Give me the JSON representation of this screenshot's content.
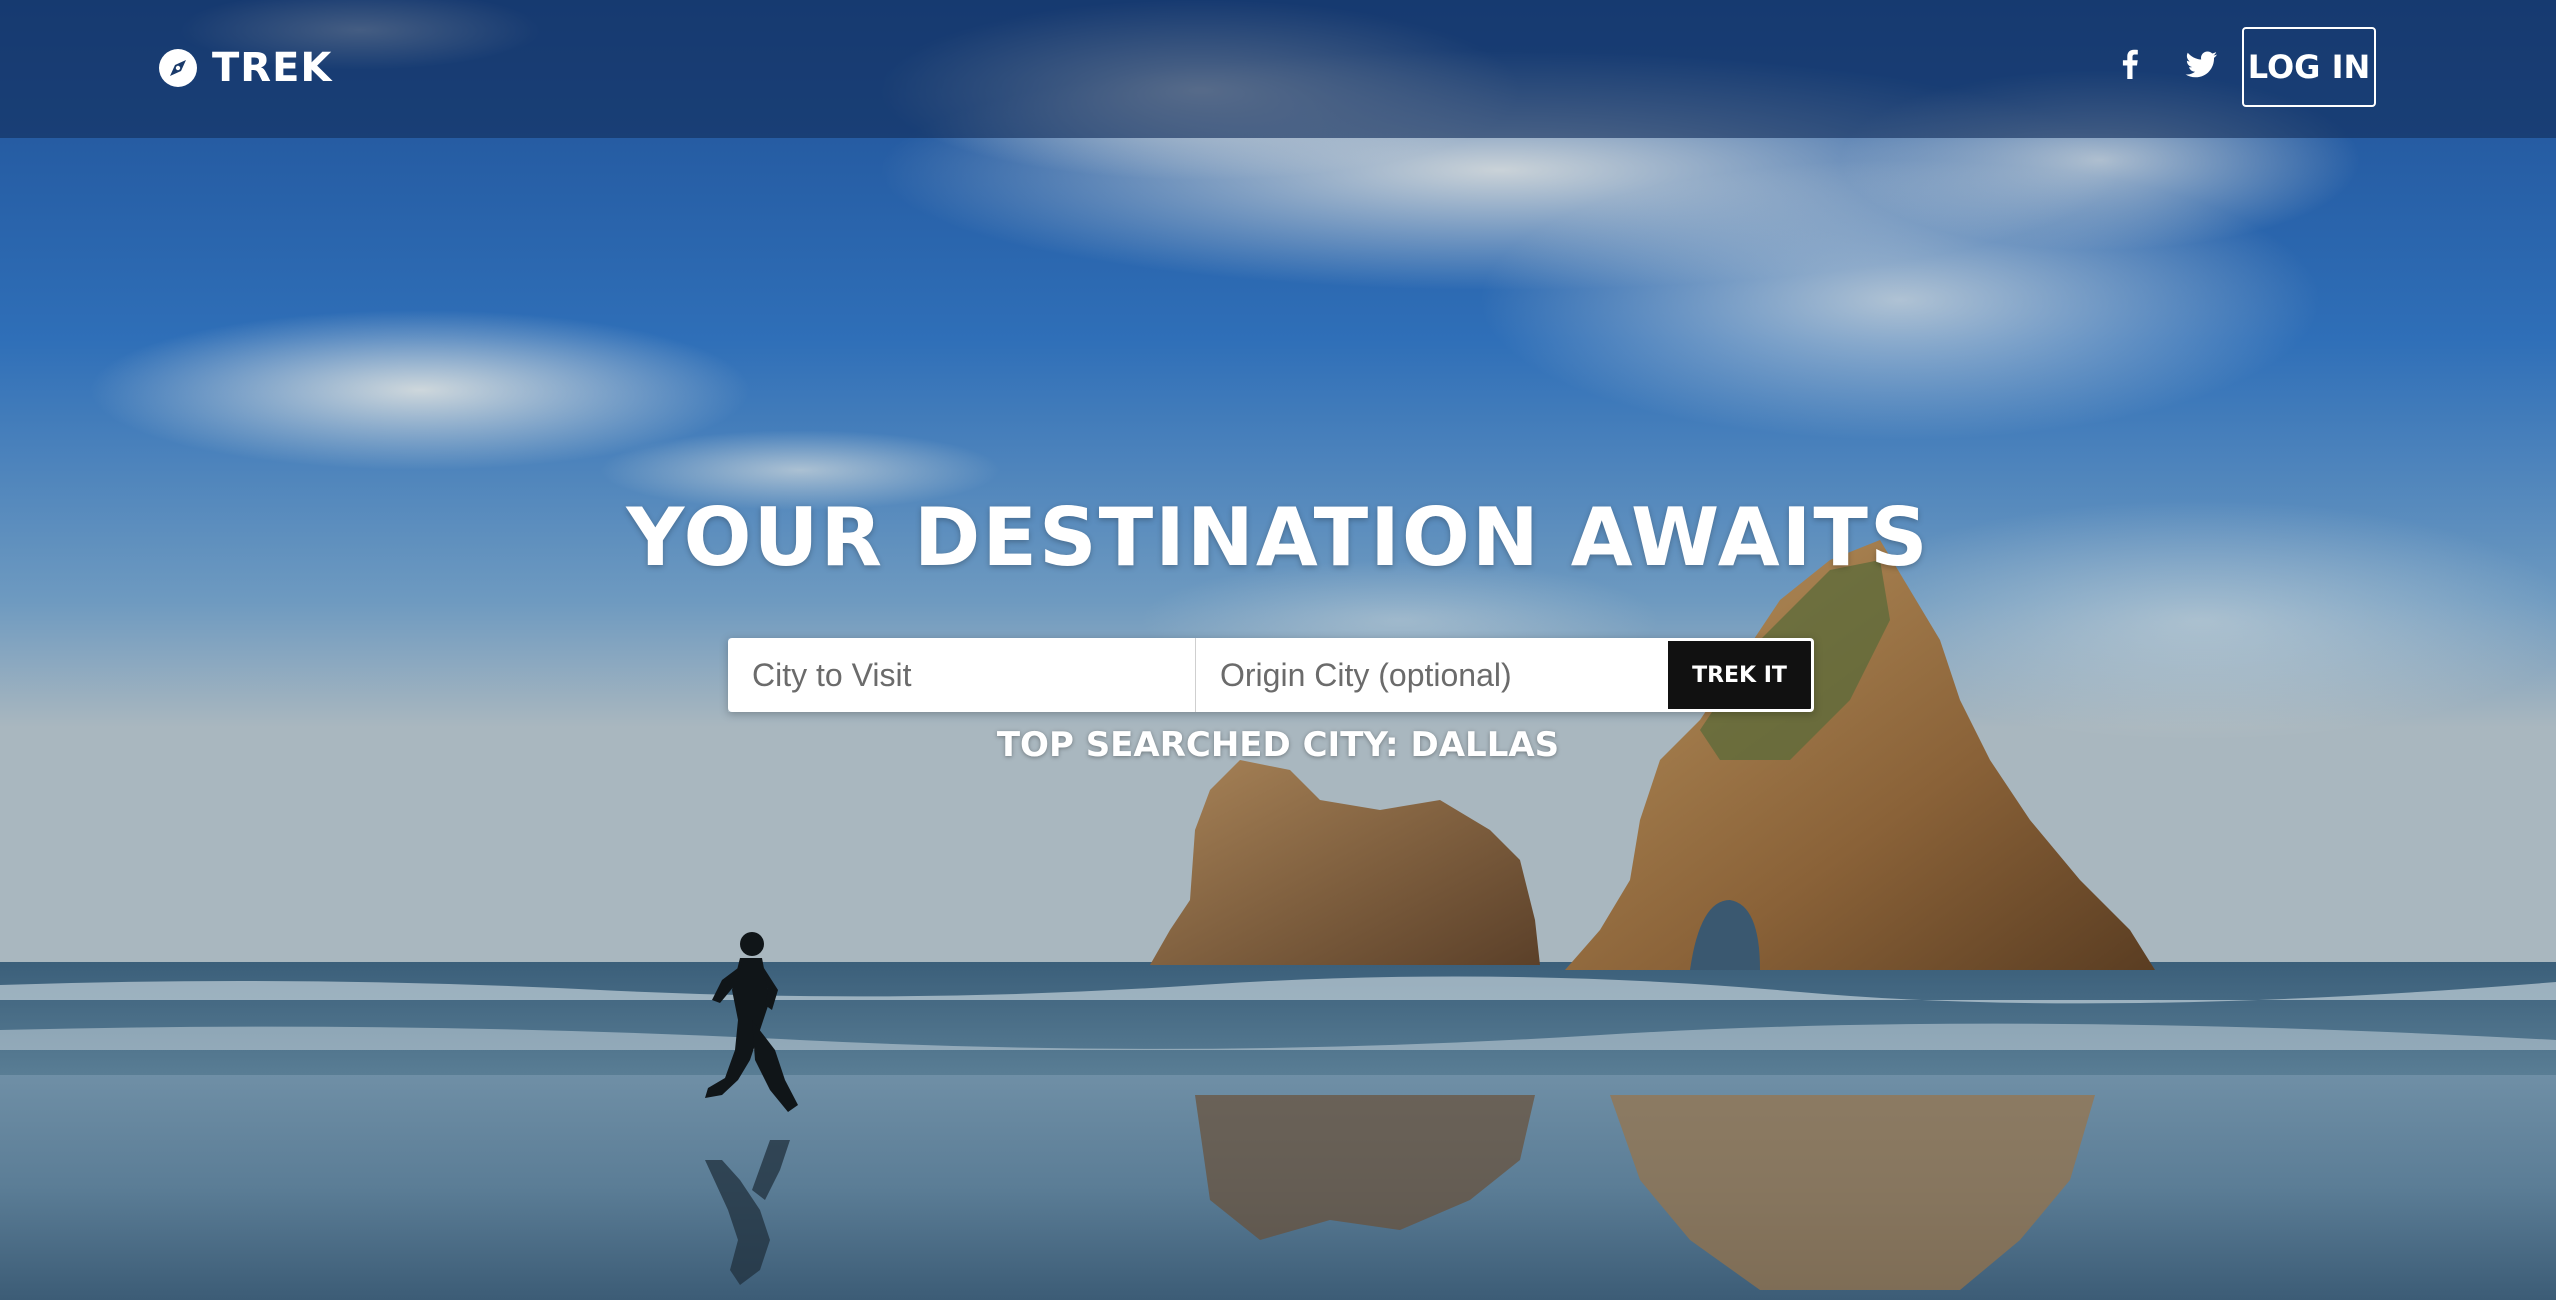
{
  "brand": {
    "name": "TREK",
    "icon": "compass-icon"
  },
  "nav": {
    "facebook_icon": "facebook-icon",
    "twitter_icon": "twitter-icon",
    "login_label": "LOG IN"
  },
  "hero": {
    "title": "YOUR DESTINATION AWAITS",
    "background": "beach-with-sea-stacks-and-runner"
  },
  "search": {
    "city_placeholder": "City to Visit",
    "city_value": "",
    "origin_placeholder": "Origin City (optional)",
    "origin_value": "",
    "submit_label": "TREK IT"
  },
  "top_searched": {
    "text": "TOP SEARCHED CITY: DALLAS"
  },
  "colors": {
    "nav_bg": "#122d5a",
    "button_bg": "#111111",
    "text": "#ffffff"
  }
}
